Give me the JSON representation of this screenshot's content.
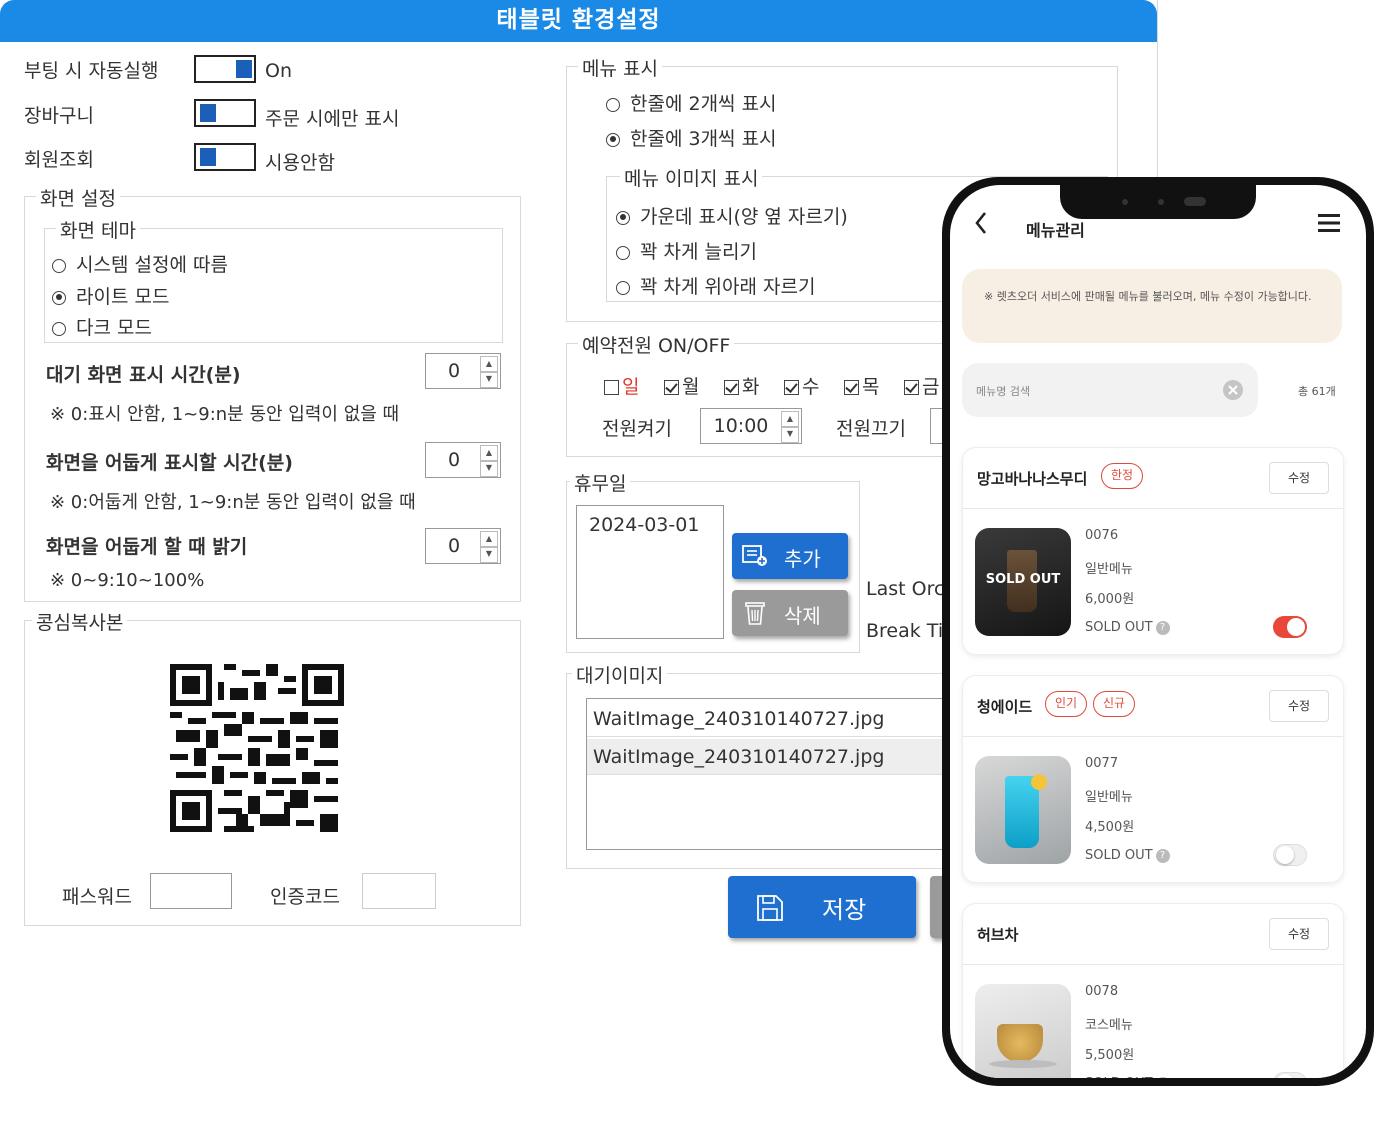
{
  "window": {
    "title": "태블릿 환경설정"
  },
  "top": {
    "boot_label": "부팅 시 자동실행",
    "boot_value": "On",
    "cart_label": "장바구니",
    "cart_value": "주문 시에만 표시",
    "member_label": "회원조회",
    "member_value": "시용안함"
  },
  "screen_settings": {
    "title": "화면 설정",
    "theme_title": "화면 테마",
    "themes": [
      "시스템 설정에 따름",
      "라이트 모드",
      "다크 모드"
    ],
    "selected_theme": 1,
    "wait_label": "대기 화면 표시 시간(분)",
    "wait_value": "0",
    "wait_note": "※ 0:표시 안함, 1~9:n분 동안 입력이 없을 때",
    "dim_label": "화면을 어둡게 표시할 시간(분)",
    "dim_value": "0",
    "dim_note": "※ 0:어둡게 안함, 1~9:n분 동안 입력이 없을 때",
    "bright_label": "화면을 어둡게 할 때 밝기",
    "bright_value": "0",
    "bright_note": "※ 0~9:10~100%"
  },
  "qr": {
    "title": "콩심복사본",
    "password_label": "패스워드",
    "auth_label": "인증코드"
  },
  "menu_display": {
    "title": "메뉴 표시",
    "options": [
      "한줄에 2개씩 표시",
      "한줄에 3개씩 표시"
    ],
    "selected": 1,
    "image_title": "메뉴 이미지 표시",
    "image_options": [
      "가운데 표시(양 옆 자르기)",
      "꽉 차게 늘리기",
      "꽉 차게 위아래 자르기"
    ],
    "image_selected": 0
  },
  "power": {
    "title": "예약전원 ON/OFF",
    "days": [
      "일",
      "월",
      "화",
      "수",
      "목",
      "금"
    ],
    "days_checked": [
      false,
      true,
      true,
      true,
      true,
      true
    ],
    "on_label": "전원켜기",
    "on_value": "10:00",
    "off_label": "전원끄기"
  },
  "holiday": {
    "title": "휴무일",
    "date": "2024-03-01",
    "add_label": "추가",
    "delete_label": "삭제"
  },
  "partial": {
    "last_order": "Last Orc",
    "break_time": "Break Ti"
  },
  "wait_image": {
    "title": "대기이미지",
    "files": [
      "WaitImage_240310140727.jpg",
      "WaitImage_240310140727.jpg"
    ]
  },
  "save_label": "저장",
  "colors": {
    "titlebar": "#1b8ae6",
    "button_blue": "#1f6fd0",
    "button_gray": "#9a9a9a",
    "toggle_on": "#e8473a",
    "notice_bg": "#f7efe4"
  },
  "phone": {
    "header_title": "메뉴관리",
    "notice": "※ 렛츠오더 서비스에 판매될 메뉴를 불러오며, 메뉴 수정이 가능합니다.",
    "search_placeholder": "메뉴명 검색",
    "total": "총 61개",
    "edit_label": "수정",
    "sold_out_label": "SOLD OUT",
    "items": [
      {
        "name": "망고바나나스무디",
        "badges": [
          "한정"
        ],
        "code": "0076",
        "type": "일반메뉴",
        "price": "6,000원",
        "sold_out": true,
        "overlay": "SOLD OUT"
      },
      {
        "name": "청에이드",
        "badges": [
          "인기",
          "신규"
        ],
        "code": "0077",
        "type": "일반메뉴",
        "price": "4,500원",
        "sold_out": false
      },
      {
        "name": "허브차",
        "badges": [],
        "code": "0078",
        "type": "코스메뉴",
        "price": "5,500원",
        "sold_out": false
      }
    ]
  }
}
